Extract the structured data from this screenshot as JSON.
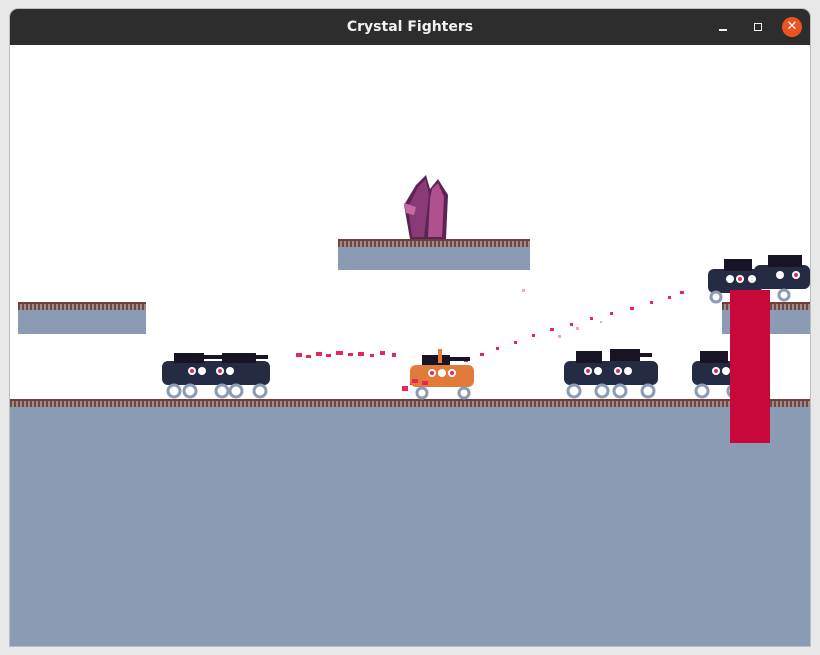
{
  "window": {
    "title": "Crystal Fighters",
    "controls": {
      "minimize": "–",
      "maximize": "□",
      "close": "✕"
    }
  },
  "colors": {
    "titlebar": "#2d2d2d",
    "close_button": "#e95420",
    "platform_fill": "#8b9bb4",
    "platform_edge": "#6b3f3a",
    "enemy_body": "#262b44",
    "player_body": "#e07b3a",
    "crystal": "#8b3a78",
    "barrier": "#c8083a",
    "particles": "#e8245a"
  },
  "icons": {
    "crystal": "crystal-icon",
    "enemy": "enemy-tank-icon",
    "player": "player-tank-icon"
  }
}
